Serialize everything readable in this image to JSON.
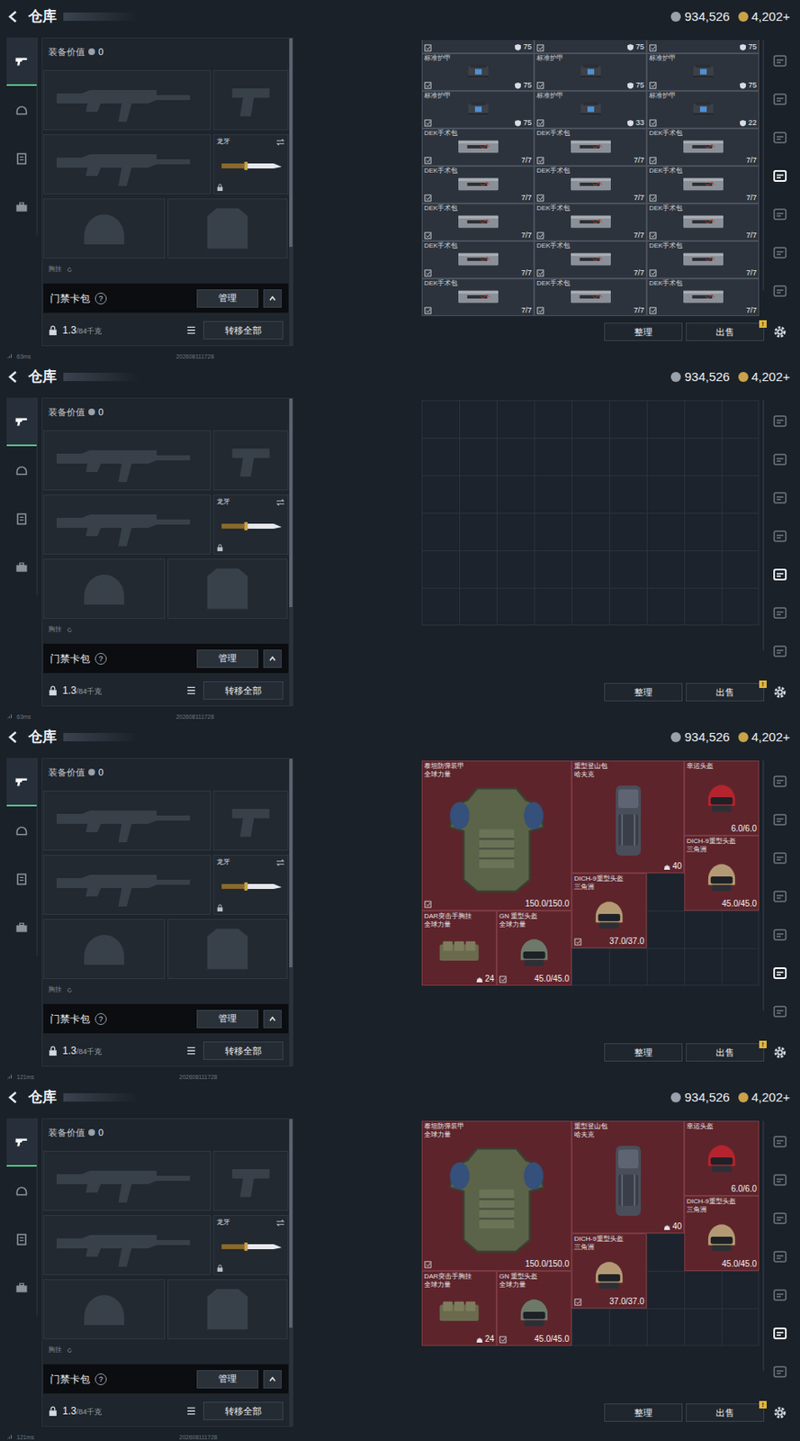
{
  "panels": [
    {
      "header": {
        "title": "仓库",
        "currencies": [
          "934,526",
          "4,202+"
        ]
      },
      "side_tabs": [
        {
          "selected": true
        },
        {
          "selected": false
        },
        {
          "selected": false
        },
        {
          "selected": false
        }
      ],
      "loadout": {
        "value_label": "装备价值",
        "value": "0",
        "knife": "龙牙",
        "small_label": "胸挂",
        "keycard": "门禁卡包",
        "help": "?",
        "manage": "管理",
        "weight": "1.3",
        "weight_max": "/84千克",
        "transfer": "转移全部"
      },
      "storage": {
        "mode": "list",
        "partial": [
          {
            "kind": "armor",
            "value": "75",
            "marked": true
          },
          {
            "kind": "armor",
            "value": "75",
            "marked": true
          },
          {
            "kind": "armor",
            "value": "75",
            "marked": true
          }
        ],
        "items": [
          {
            "name": "标准护甲",
            "kind": "armor",
            "value": "75",
            "marked": true
          },
          {
            "name": "标准护甲",
            "kind": "armor",
            "value": "75",
            "marked": true
          },
          {
            "name": "标准护甲",
            "kind": "armor",
            "value": "75",
            "marked": true
          },
          {
            "name": "标准护甲",
            "kind": "armor",
            "value": "75",
            "marked": true
          },
          {
            "name": "标准护甲",
            "kind": "armor",
            "value": "33",
            "marked": true
          },
          {
            "name": "标准护甲",
            "kind": "armor",
            "value": "22",
            "marked": true
          },
          {
            "name": "DEK手术包",
            "kind": "medkit",
            "value": "7/7",
            "marked": true
          },
          {
            "name": "DEK手术包",
            "kind": "medkit",
            "value": "7/7",
            "marked": true
          },
          {
            "name": "DEK手术包",
            "kind": "medkit",
            "value": "7/7",
            "marked": true
          },
          {
            "name": "DEK手术包",
            "kind": "medkit",
            "value": "7/7",
            "marked": true
          },
          {
            "name": "DEK手术包",
            "kind": "medkit",
            "value": "7/7",
            "marked": true
          },
          {
            "name": "DEK手术包",
            "kind": "medkit",
            "value": "7/7",
            "marked": true
          },
          {
            "name": "DEK手术包",
            "kind": "medkit",
            "value": "7/7",
            "marked": true
          },
          {
            "name": "DEK手术包",
            "kind": "medkit",
            "value": "7/7",
            "marked": true
          },
          {
            "name": "DEK手术包",
            "kind": "medkit",
            "value": "7/7",
            "marked": true
          },
          {
            "name": "DEK手术包",
            "kind": "medkit",
            "value": "7/7",
            "marked": true
          },
          {
            "name": "DEK手术包",
            "kind": "medkit",
            "value": "7/7",
            "marked": true
          },
          {
            "name": "DEK手术包",
            "kind": "medkit",
            "value": "7/7",
            "marked": true
          },
          {
            "name": "DEK手术包",
            "kind": "medkit",
            "value": "7/7",
            "marked": true
          },
          {
            "name": "DEK手术包",
            "kind": "medkit",
            "value": "7/7",
            "marked": true
          },
          {
            "name": "DEK手术包",
            "kind": "medkit",
            "value": "7/7",
            "marked": true
          }
        ]
      },
      "storage_tabs": [
        {
          "selected": false
        },
        {
          "selected": false
        },
        {
          "selected": false
        },
        {
          "selected": true
        },
        {
          "selected": false
        },
        {
          "selected": false
        },
        {
          "selected": false
        }
      ],
      "buttons": [
        "整理",
        "出售"
      ],
      "badge": "!",
      "status": {
        "ping": "63ms",
        "build": "202608111728"
      }
    },
    {
      "header": {
        "title": "仓库",
        "currencies": [
          "934,526",
          "4,202+"
        ]
      },
      "side_tabs": [
        {
          "selected": true
        },
        {
          "selected": false
        },
        {
          "selected": false
        },
        {
          "selected": false
        }
      ],
      "loadout": {
        "value_label": "装备价值",
        "value": "0",
        "knife": "龙牙",
        "small_label": "胸挂",
        "keycard": "门禁卡包",
        "help": "?",
        "manage": "管理",
        "weight": "1.3",
        "weight_max": "/84千克",
        "transfer": "转移全部"
      },
      "storage": {
        "mode": "grid",
        "partial": [],
        "items": []
      },
      "storage_tabs": [
        {
          "selected": false
        },
        {
          "selected": false
        },
        {
          "selected": false
        },
        {
          "selected": false
        },
        {
          "selected": true
        },
        {
          "selected": false
        },
        {
          "selected": false
        }
      ],
      "buttons": [
        "整理",
        "出售"
      ],
      "badge": "!",
      "status": {
        "ping": "63ms",
        "build": "202608111728"
      }
    },
    {
      "header": {
        "title": "仓库",
        "currencies": [
          "934,526",
          "4,202+"
        ]
      },
      "side_tabs": [
        {
          "selected": true
        },
        {
          "selected": false
        },
        {
          "selected": false
        },
        {
          "selected": false
        }
      ],
      "loadout": {
        "value_label": "装备价值",
        "value": "0",
        "knife": "龙牙",
        "small_label": "胸挂",
        "keycard": "门禁卡包",
        "help": "?",
        "manage": "管理",
        "weight": "1.3",
        "weight_max": "/84千克",
        "transfer": "转移全部"
      },
      "storage": {
        "mode": "grid",
        "partial": [],
        "items": [
          {
            "name": "泰坦防弹装甲",
            "brand": "全球力量",
            "kind": "vest",
            "value": "150.0/150.0",
            "marked": true,
            "col": 1,
            "row": 1,
            "w": 4,
            "h": 4
          },
          {
            "name": "重型登山包",
            "brand": "哈夫克",
            "kind": "backpack",
            "value": "40",
            "marked": false,
            "col": 5,
            "row": 1,
            "w": 3,
            "h": 3
          },
          {
            "name": "幸运头盔",
            "brand": "",
            "kind": "helmet-red",
            "value": "6.0/6.0",
            "marked": false,
            "col": 8,
            "row": 1,
            "w": 2,
            "h": 2
          },
          {
            "name": "DICH-9重型头盔",
            "brand": "三角洲",
            "kind": "helmet",
            "value": "45.0/45.0",
            "marked": false,
            "col": 8,
            "row": 3,
            "w": 2,
            "h": 2
          },
          {
            "name": "DICH-9重型头盔",
            "brand": "三角洲",
            "kind": "helmet",
            "value": "37.0/37.0",
            "marked": true,
            "col": 5,
            "row": 4,
            "w": 2,
            "h": 2
          },
          {
            "name": "DAR突击手胸挂",
            "brand": "全球力量",
            "kind": "rig",
            "value": "24",
            "marked": false,
            "col": 1,
            "row": 5,
            "w": 2,
            "h": 2
          },
          {
            "name": "GN 重型头盔",
            "brand": "全球力量",
            "kind": "helmet-green",
            "value": "45.0/45.0",
            "marked": true,
            "col": 3,
            "row": 5,
            "w": 2,
            "h": 2
          }
        ]
      },
      "storage_tabs": [
        {
          "selected": false
        },
        {
          "selected": false
        },
        {
          "selected": false
        },
        {
          "selected": false
        },
        {
          "selected": false
        },
        {
          "selected": true
        },
        {
          "selected": false
        }
      ],
      "buttons": [
        "整理",
        "出售"
      ],
      "badge": "!",
      "status": {
        "ping": "121ms",
        "build": "202608111728"
      }
    },
    {
      "header": {
        "title": "仓库",
        "currencies": [
          "934,526",
          "4,202+"
        ]
      },
      "side_tabs": [
        {
          "selected": true
        },
        {
          "selected": false
        },
        {
          "selected": false
        },
        {
          "selected": false
        }
      ],
      "loadout": {
        "value_label": "装备价值",
        "value": "0",
        "knife": "龙牙",
        "small_label": "胸挂",
        "keycard": "门禁卡包",
        "help": "?",
        "manage": "管理",
        "weight": "1.3",
        "weight_max": "/84千克",
        "transfer": "转移全部"
      },
      "storage": {
        "mode": "grid",
        "partial": [],
        "items": [
          {
            "name": "泰坦防弹装甲",
            "brand": "全球力量",
            "kind": "vest",
            "value": "150.0/150.0",
            "marked": true,
            "col": 1,
            "row": 1,
            "w": 4,
            "h": 4
          },
          {
            "name": "重型登山包",
            "brand": "哈夫克",
            "kind": "backpack",
            "value": "40",
            "marked": false,
            "col": 5,
            "row": 1,
            "w": 3,
            "h": 3
          },
          {
            "name": "幸运头盔",
            "brand": "",
            "kind": "helmet-red",
            "value": "6.0/6.0",
            "marked": false,
            "col": 8,
            "row": 1,
            "w": 2,
            "h": 2
          },
          {
            "name": "DICH-9重型头盔",
            "brand": "三角洲",
            "kind": "helmet",
            "value": "45.0/45.0",
            "marked": false,
            "col": 8,
            "row": 3,
            "w": 2,
            "h": 2
          },
          {
            "name": "DICH-9重型头盔",
            "brand": "三角洲",
            "kind": "helmet",
            "value": "37.0/37.0",
            "marked": true,
            "col": 5,
            "row": 4,
            "w": 2,
            "h": 2
          },
          {
            "name": "DAR突击手胸挂",
            "brand": "全球力量",
            "kind": "rig",
            "value": "24",
            "marked": false,
            "col": 1,
            "row": 5,
            "w": 2,
            "h": 2
          },
          {
            "name": "GN 重型头盔",
            "brand": "全球力量",
            "kind": "helmet-green",
            "value": "45.0/45.0",
            "marked": true,
            "col": 3,
            "row": 5,
            "w": 2,
            "h": 2
          }
        ]
      },
      "storage_tabs": [
        {
          "selected": false
        },
        {
          "selected": false
        },
        {
          "selected": false
        },
        {
          "selected": false
        },
        {
          "selected": false
        },
        {
          "selected": true
        },
        {
          "selected": false
        }
      ],
      "buttons": [
        "整理",
        "出售"
      ],
      "badge": "!",
      "status": {
        "ping": "121ms",
        "build": "202608111728"
      }
    }
  ]
}
